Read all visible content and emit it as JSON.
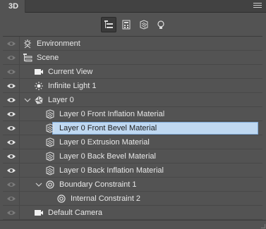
{
  "panel": {
    "tab_label": "3D"
  },
  "toolbar": {
    "filters": [
      {
        "name": "scene-filter",
        "active": true
      },
      {
        "name": "meshes-filter",
        "active": false
      },
      {
        "name": "materials-filter",
        "active": false
      },
      {
        "name": "lights-filter",
        "active": false
      }
    ]
  },
  "tree": {
    "rows": [
      {
        "label": "Environment",
        "icon": "environment-icon",
        "indent": 0,
        "visible_dim": true
      },
      {
        "label": "Scene",
        "icon": "scene-icon",
        "indent": 0,
        "visible_dim": true
      },
      {
        "label": "Current View",
        "icon": "camera-icon",
        "indent": 1,
        "visible_dim": true
      },
      {
        "label": "Infinite Light 1",
        "icon": "light-icon",
        "indent": 1,
        "visible_dim": false
      },
      {
        "label": "Layer 0",
        "icon": "mesh-icon",
        "indent": 1,
        "visible_dim": false,
        "expanded": true
      },
      {
        "label": "Layer 0 Front Inflation Material",
        "icon": "material-icon",
        "indent": 2,
        "visible_dim": false
      },
      {
        "label": "Layer 0 Front Bevel Material",
        "icon": "material-icon",
        "indent": 2,
        "visible_dim": false,
        "selected": true
      },
      {
        "label": "Layer 0 Extrusion Material",
        "icon": "material-icon",
        "indent": 2,
        "visible_dim": false
      },
      {
        "label": "Layer 0 Back Bevel Material",
        "icon": "material-icon",
        "indent": 2,
        "visible_dim": false
      },
      {
        "label": "Layer 0 Back Inflation Material",
        "icon": "material-icon",
        "indent": 2,
        "visible_dim": false
      },
      {
        "label": "Boundary Constraint 1",
        "icon": "constraint-icon",
        "indent": 2,
        "visible_dim": true,
        "expanded": true
      },
      {
        "label": "Internal Constraint 2",
        "icon": "constraint-icon",
        "indent": 3,
        "visible_dim": true
      },
      {
        "label": "Default Camera",
        "icon": "camera-icon",
        "indent": 1,
        "visible_dim": true
      }
    ]
  },
  "colors": {
    "panel_bg": "#535353",
    "selection_bg": "#bfd8f1",
    "selection_border": "#7fa9d6",
    "text": "#e8e8e8"
  }
}
